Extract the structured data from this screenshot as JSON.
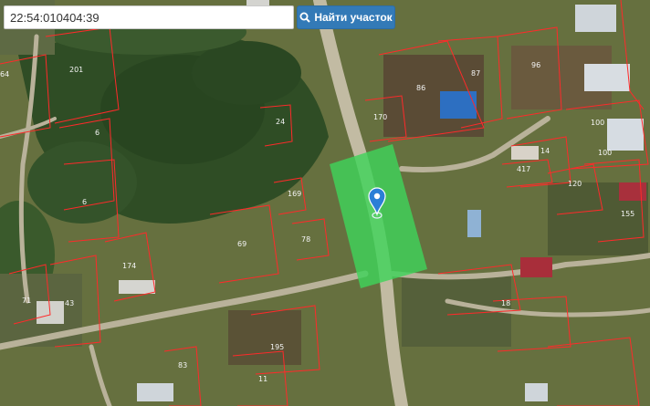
{
  "search": {
    "value": "22:54:010404:39",
    "button_label": "Найти участок",
    "button_icon": "search-icon"
  },
  "map": {
    "selected_parcel_color": "#3fd35a",
    "boundary_color": "#ff2a2a",
    "marker_icon": "map-pin-icon",
    "parcel_labels": [
      "64",
      "201",
      "6",
      "6",
      "24",
      "170",
      "86",
      "87",
      "96",
      "100",
      "100",
      "14",
      "417",
      "120",
      "155",
      "169",
      "78",
      "69",
      "174",
      "71",
      "43",
      "18",
      "195",
      "83",
      "11"
    ]
  }
}
